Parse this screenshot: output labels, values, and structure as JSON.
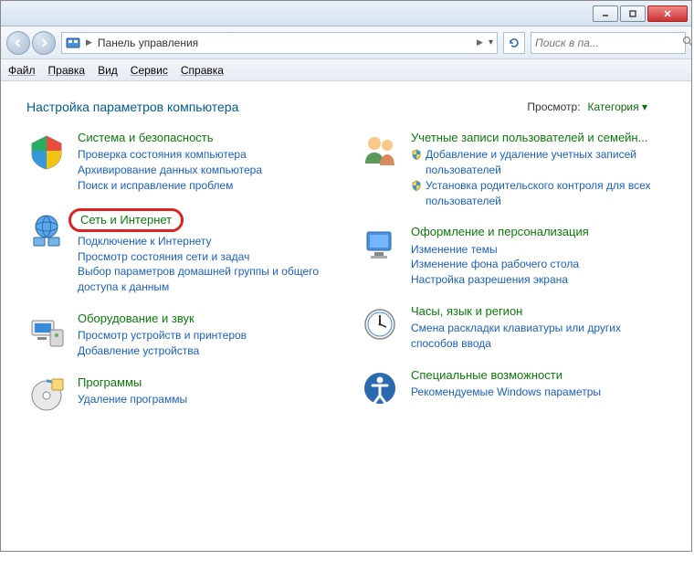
{
  "titlebar": {
    "min": "_",
    "max": "▢",
    "close": "✕"
  },
  "address": {
    "text": "Панель управления",
    "arrow": "▶"
  },
  "search": {
    "placeholder": "Поиск в па..."
  },
  "menus": [
    "Файл",
    "Правка",
    "Вид",
    "Сервис",
    "Справка"
  ],
  "heading": "Настройка параметров компьютера",
  "view": {
    "label": "Просмотр:",
    "value": "Категория"
  },
  "left": [
    {
      "title": "Система и безопасность",
      "links": [
        "Проверка состояния компьютера",
        "Архивирование данных компьютера",
        "Поиск и исправление проблем"
      ]
    },
    {
      "title": "Сеть и Интернет",
      "highlight": true,
      "links": [
        "Подключение к Интернету",
        "Просмотр состояния сети и задач",
        "Выбор параметров домашней группы и общего доступа к данным"
      ]
    },
    {
      "title": "Оборудование и звук",
      "links": [
        "Просмотр устройств и принтеров",
        "Добавление устройства"
      ]
    },
    {
      "title": "Программы",
      "links": [
        "Удаление программы"
      ]
    }
  ],
  "right": [
    {
      "title": "Учетные записи пользователей и семейн...",
      "links": [
        {
          "text": "Добавление и удаление учетных записей пользователей",
          "shield": true
        },
        {
          "text": "Установка родительского контроля для всех пользователей",
          "shield": true
        }
      ]
    },
    {
      "title": "Оформление и персонализация",
      "links": [
        "Изменение темы",
        "Изменение фона рабочего стола",
        "Настройка разрешения экрана"
      ]
    },
    {
      "title": "Часы, язык и регион",
      "links": [
        "Смена раскладки клавиатуры или других способов ввода"
      ]
    },
    {
      "title": "Специальные возможности",
      "links": [
        "Рекомендуемые Windows параметры"
      ]
    }
  ]
}
